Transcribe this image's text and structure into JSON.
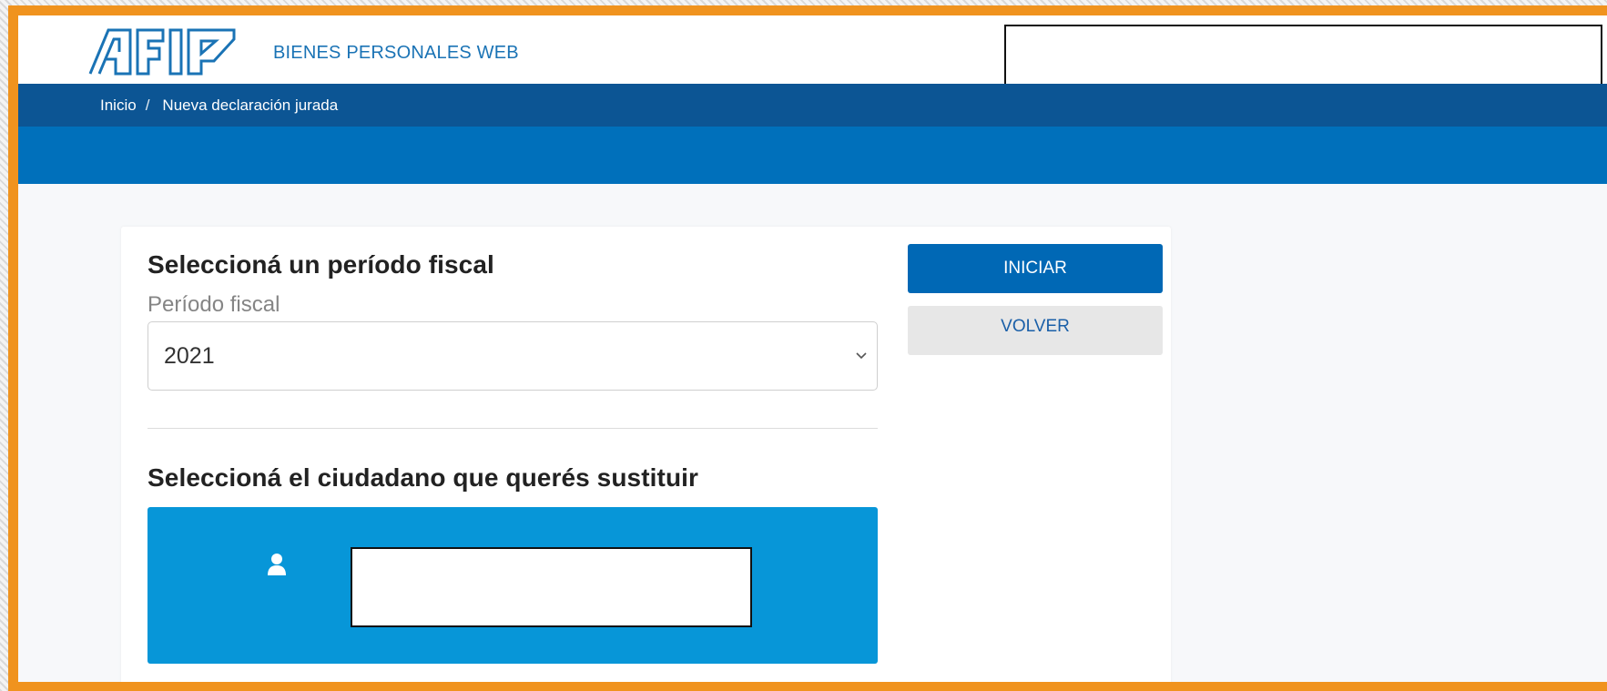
{
  "header": {
    "app_title": "BIENES PERSONALES WEB",
    "logo_text": "AFIP"
  },
  "breadcrumb": {
    "items": [
      "Inicio",
      "Nueva declaración jurada"
    ],
    "separator": "/"
  },
  "form": {
    "period_heading": "Seleccioná un período fiscal",
    "period_label": "Período fiscal",
    "period_value": "2021",
    "citizen_heading": "Seleccioná el ciudadano que querés sustituir"
  },
  "actions": {
    "start_label": "INICIAR",
    "back_label": "VOLVER"
  },
  "colors": {
    "frame": "#f0931e",
    "breadcrumb_bar": "#0c5594",
    "band": "#0070bb",
    "primary_button": "#0068b5",
    "person_card": "#0796d8"
  },
  "icons": {
    "select_arrow": "chevron-down-icon",
    "citizen": "user-icon"
  }
}
